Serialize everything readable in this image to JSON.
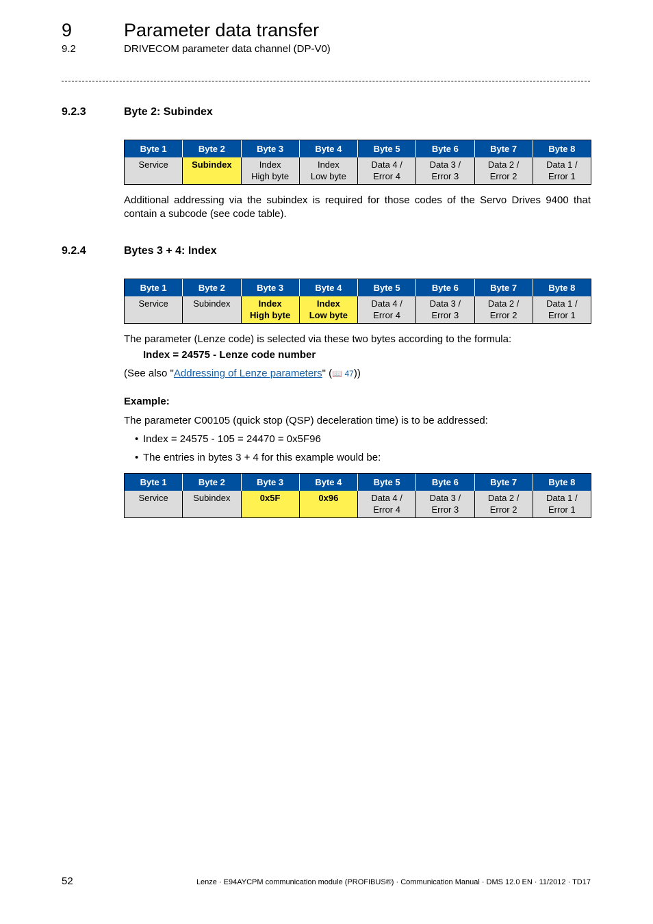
{
  "header": {
    "chapter_number": "9",
    "chapter_title": "Parameter data transfer",
    "section_number": "9.2",
    "section_title": "DRIVECOM parameter data channel (DP-V0)"
  },
  "section_923": {
    "number": "9.2.3",
    "title": "Byte 2: Subindex",
    "table": {
      "headers": [
        "Byte 1",
        "Byte 2",
        "Byte 3",
        "Byte 4",
        "Byte 5",
        "Byte 6",
        "Byte 7",
        "Byte 8"
      ],
      "cells": [
        [
          "Service"
        ],
        [
          "Subindex"
        ],
        [
          "Index",
          "High byte"
        ],
        [
          "Index",
          "Low byte"
        ],
        [
          "Data 4 /",
          "Error 4"
        ],
        [
          "Data 3 /",
          "Error 3"
        ],
        [
          "Data 2 /",
          "Error 2"
        ],
        [
          "Data 1 /",
          "Error 1"
        ]
      ],
      "highlighted": [
        1
      ]
    },
    "paragraph": "Additional addressing via the subindex is required for those codes of the Servo Drives 9400 that contain a subcode (see code table)."
  },
  "section_924": {
    "number": "9.2.4",
    "title": "Bytes 3 + 4: Index",
    "table": {
      "headers": [
        "Byte 1",
        "Byte 2",
        "Byte 3",
        "Byte 4",
        "Byte 5",
        "Byte 6",
        "Byte 7",
        "Byte 8"
      ],
      "cells": [
        [
          "Service"
        ],
        [
          "Subindex"
        ],
        [
          "Index",
          "High byte"
        ],
        [
          "Index",
          "Low byte"
        ],
        [
          "Data 4 /",
          "Error 4"
        ],
        [
          "Data 3 /",
          "Error 3"
        ],
        [
          "Data 2 /",
          "Error 2"
        ],
        [
          "Data 1 /",
          "Error 1"
        ]
      ],
      "highlighted": [
        2,
        3
      ]
    },
    "paragraph": "The parameter (Lenze code) is selected via these two bytes according to the formula:",
    "formula": "Index = 24575 - Lenze code number",
    "see_also_prefix": "(See also \"",
    "see_also_link": "Addressing of Lenze parameters",
    "see_also_mid": "\" (",
    "see_also_ref_icon": "book-icon",
    "see_also_ref": "47",
    "see_also_suffix": "))",
    "example_label": "Example:",
    "example_text": "The parameter C00105 (quick stop (QSP) deceleration time) is to be addressed:",
    "bullets": [
      "Index = 24575 - 105 = 24470 = 0x5F96",
      "The entries in bytes 3 + 4 for this example would be:"
    ],
    "example_table": {
      "headers": [
        "Byte 1",
        "Byte 2",
        "Byte 3",
        "Byte 4",
        "Byte 5",
        "Byte 6",
        "Byte 7",
        "Byte 8"
      ],
      "cells": [
        [
          "Service"
        ],
        [
          "Subindex"
        ],
        [
          "0x5F"
        ],
        [
          "0x96"
        ],
        [
          "Data 4 /",
          "Error 4"
        ],
        [
          "Data 3 /",
          "Error 3"
        ],
        [
          "Data 2 /",
          "Error 2"
        ],
        [
          "Data 1 /",
          "Error 1"
        ]
      ],
      "highlighted": [
        2,
        3
      ]
    }
  },
  "footer": {
    "page_number": "52",
    "text": "Lenze · E94AYCPM communication module (PROFIBUS®) · Communication Manual · DMS 12.0 EN · 11/2012 · TD17"
  },
  "colors": {
    "header_blue": "#0050a0",
    "cell_gray": "#dcdcdc",
    "highlight_yellow": "#fff250",
    "link_blue": "#1560a8"
  }
}
